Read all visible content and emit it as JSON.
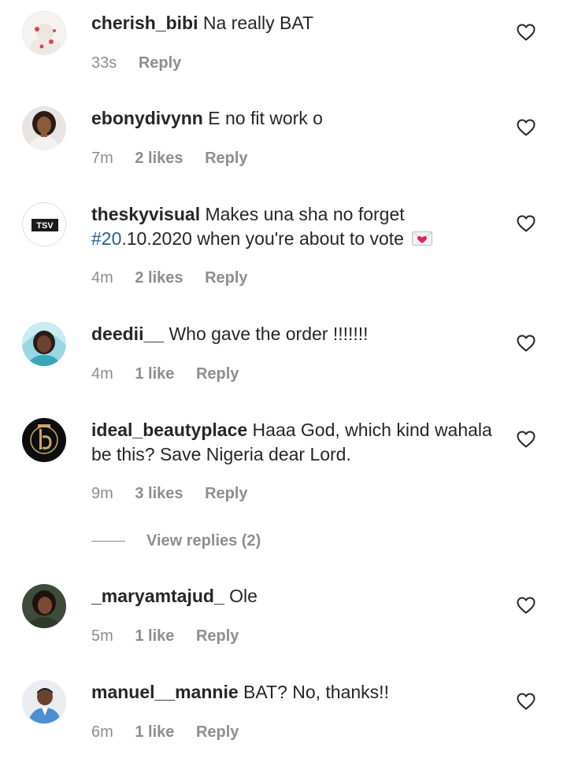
{
  "comments": [
    {
      "username": "cherish_bibi",
      "text": "Na really BAT",
      "time": "33s",
      "likes": "",
      "reply": "Reply",
      "avatar": "avatar-cherish"
    },
    {
      "username": "ebonydivynn",
      "text": "E no fit work o",
      "time": "7m",
      "likes": "2 likes",
      "reply": "Reply",
      "avatar": "avatar-ebony"
    },
    {
      "username": "theskyvisual",
      "text_before": "Makes una sha no forget",
      "hashtag": "#20",
      "text_after": ".10.2020 when you're about to vote",
      "emoji": "love-letter-emoji",
      "time": "4m",
      "likes": "2 likes",
      "reply": "Reply",
      "avatar_text": "TSV"
    },
    {
      "username": "deedii__",
      "text": "Who gave the order !!!!!!!",
      "time": "4m",
      "likes": "1 like",
      "reply": "Reply",
      "avatar": "avatar-deedii"
    },
    {
      "username": "ideal_beautyplace",
      "text": "Haaa God, which kind wahala be this? Save Nigeria dear Lord.",
      "time": "9m",
      "likes": "3 likes",
      "reply": "Reply",
      "avatar": "avatar-ideal"
    },
    {
      "username": "_maryamtajud_",
      "text": "Ole",
      "time": "5m",
      "likes": "1 like",
      "reply": "Reply",
      "avatar": "avatar-maryam"
    },
    {
      "username": "manuel__mannie",
      "text": "BAT? No, thanks!!",
      "time": "6m",
      "likes": "1 like",
      "reply": "Reply",
      "avatar": "avatar-manuel"
    }
  ],
  "view_replies": {
    "label": "View replies (2)"
  },
  "colors": {
    "text": "#262626",
    "secondary": "#8e8e8e",
    "hashtag": "#2b5d8c"
  }
}
